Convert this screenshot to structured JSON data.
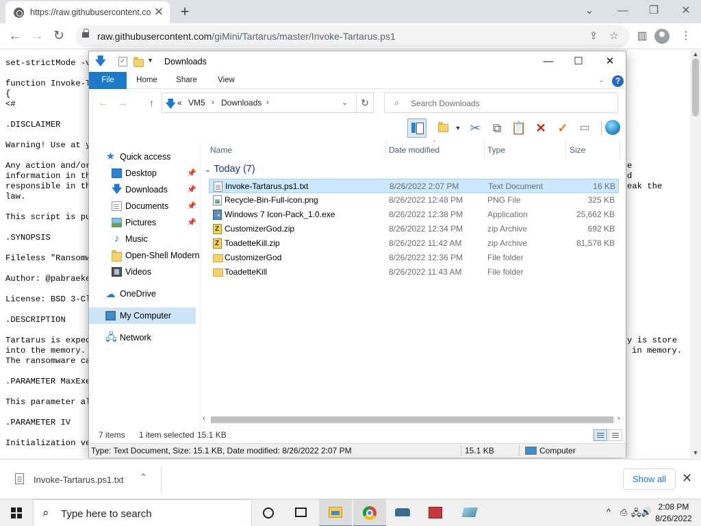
{
  "browser": {
    "tab_title": "https://raw.githubusercontent.co",
    "new_tab": "+",
    "url_host": "raw.githubusercontent.com",
    "url_path": "/giMini/Tartarus/master/Invoke-Tartarus.ps1"
  },
  "page": {
    "lines": [
      "set-strictMode -v",
      "function Invoke-T",
      "{",
      "<#",
      ".DISCLAIMER",
      "Warning! Use at y",
      "Any action and/or",
      "information in th",
      "responsible in th",
      "law.",
      "This script is pu",
      ".SYNOPSIS",
      "Fileless \"Ransomw",
      "Author: @pabraeke",
      "License: BSD 3-Cl",
      ".DESCRIPTION",
      "Tartarus is expec",
      "into the memory.",
      "The ransomware ca",
      ".PARAMETER MaxExe",
      "This parameter al",
      ".PARAMETER IV",
      "Initialization ve"
    ],
    "right_fragments": [
      "e",
      "d",
      "eak the",
      "y is store",
      "in memory."
    ]
  },
  "explorer": {
    "title": "Downloads",
    "ribbon_tabs": [
      "File",
      "Home",
      "Share",
      "View"
    ],
    "help": "?",
    "breadcrumb": [
      "VM5",
      "Downloads"
    ],
    "breadcrumb_prefix": "«",
    "search_placeholder": "Search Downloads",
    "nav": {
      "quick_access": "Quick access",
      "desktop": "Desktop",
      "downloads": "Downloads",
      "documents": "Documents",
      "pictures": "Pictures",
      "music": "Music",
      "open_shell": "Open-Shell Modern",
      "videos": "Videos",
      "onedrive": "OneDrive",
      "my_computer": "My Computer",
      "network": "Network"
    },
    "columns": [
      "Name",
      "Date modified",
      "Type",
      "Size"
    ],
    "group_label": "Today (7)",
    "files": [
      {
        "name": "Invoke-Tartarus.ps1.txt",
        "date": "8/26/2022 2:07 PM",
        "type": "Text Document",
        "size": "16 KB",
        "icon": "text-file-icon"
      },
      {
        "name": "Recycle-Bin-Full-icon.png",
        "date": "8/26/2022 12:48 PM",
        "type": "PNG File",
        "size": "325 KB",
        "icon": "png-file-icon"
      },
      {
        "name": "Windows 7 Icon-Pack_1.0.exe",
        "date": "8/26/2022 12:38 PM",
        "type": "Application",
        "size": "25,662 KB",
        "icon": "exe-file-icon"
      },
      {
        "name": "CustomizerGod.zip",
        "date": "8/26/2022 12:34 PM",
        "type": "zip Archive",
        "size": "692 KB",
        "icon": "zip-file-icon"
      },
      {
        "name": "ToadetteKill.zip",
        "date": "8/26/2022 11:42 AM",
        "type": "zip Archive",
        "size": "81,578 KB",
        "icon": "zip-file-icon"
      },
      {
        "name": "CustomizerGod",
        "date": "8/26/2022 12:36 PM",
        "type": "File folder",
        "size": "",
        "icon": "folder-icon"
      },
      {
        "name": "ToadetteKill",
        "date": "8/26/2022 11:43 AM",
        "type": "File folder",
        "size": "",
        "icon": "folder-icon"
      }
    ],
    "status": {
      "items": "7 items",
      "selected": "1 item selected",
      "sel_size": "15.1 KB"
    },
    "details": {
      "info": "Type: Text Document, Size: 15.1 KB, Date modified: 8/26/2022 2:07 PM",
      "size": "15.1 KB",
      "location": "Computer"
    }
  },
  "download_shelf": {
    "file_name": "Invoke-Tartarus.ps1.txt",
    "show_all": "Show all"
  },
  "taskbar": {
    "search_placeholder": "Type here to search",
    "time": "2:08 PM",
    "date": "8/26/2022"
  },
  "colors": {
    "accent": "#1979ca",
    "selection": "#cce8ff",
    "link_blue": "#1a73e8",
    "group_header": "#1e3287"
  }
}
